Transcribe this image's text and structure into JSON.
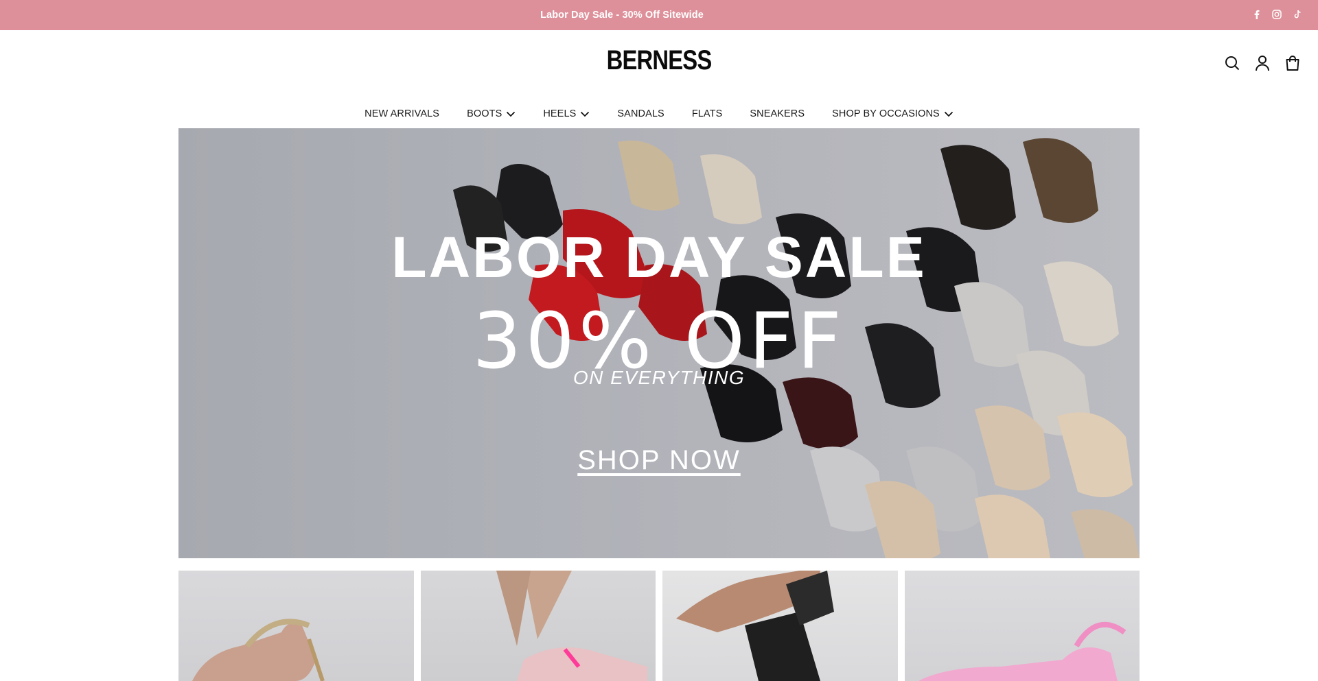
{
  "announcement": {
    "text": "Labor Day Sale - 30% Off Sitewide"
  },
  "social": {
    "icons": [
      "facebook-icon",
      "instagram-icon",
      "tiktok-icon"
    ]
  },
  "header": {
    "logo": "BERNESS",
    "icons": [
      "search-icon",
      "account-icon",
      "cart-icon"
    ]
  },
  "nav": {
    "items": [
      {
        "label": "NEW ARRIVALS",
        "dropdown": false
      },
      {
        "label": "BOOTS",
        "dropdown": true
      },
      {
        "label": "HEELS",
        "dropdown": true
      },
      {
        "label": "SANDALS",
        "dropdown": false
      },
      {
        "label": "FLATS",
        "dropdown": false
      },
      {
        "label": "SNEAKERS",
        "dropdown": false
      },
      {
        "label": "SHOP BY OCCASIONS",
        "dropdown": true
      }
    ]
  },
  "hero": {
    "title": "LABOR DAY SALE",
    "discount": "30% OFF",
    "subtitle": "ON EVERYTHING",
    "cta": "SHOP NOW"
  },
  "colors": {
    "announcement_bg": "#de909a",
    "hero_bg": "#aeb0b7",
    "text": "#111111"
  }
}
